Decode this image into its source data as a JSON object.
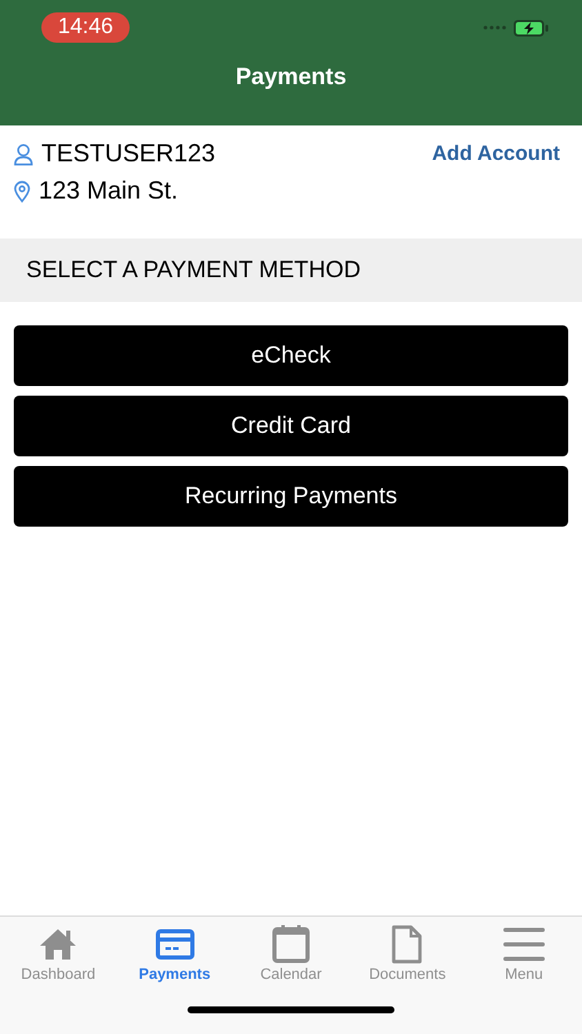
{
  "status_bar": {
    "time": "14:46"
  },
  "header": {
    "title": "Payments"
  },
  "account": {
    "username": "TESTUSER123",
    "address": "123 Main St.",
    "add_account": "Add Account"
  },
  "section": {
    "title": "SELECT A PAYMENT METHOD"
  },
  "payment_methods": [
    "eCheck",
    "Credit Card",
    "Recurring Payments"
  ],
  "tabs": [
    {
      "label": "Dashboard",
      "kind": "home",
      "selected": false
    },
    {
      "label": "Payments",
      "kind": "card",
      "selected": true
    },
    {
      "label": "Calendar",
      "kind": "calendar",
      "selected": false
    },
    {
      "label": "Documents",
      "kind": "document",
      "selected": false
    },
    {
      "label": "Menu",
      "kind": "menu",
      "selected": false
    }
  ]
}
